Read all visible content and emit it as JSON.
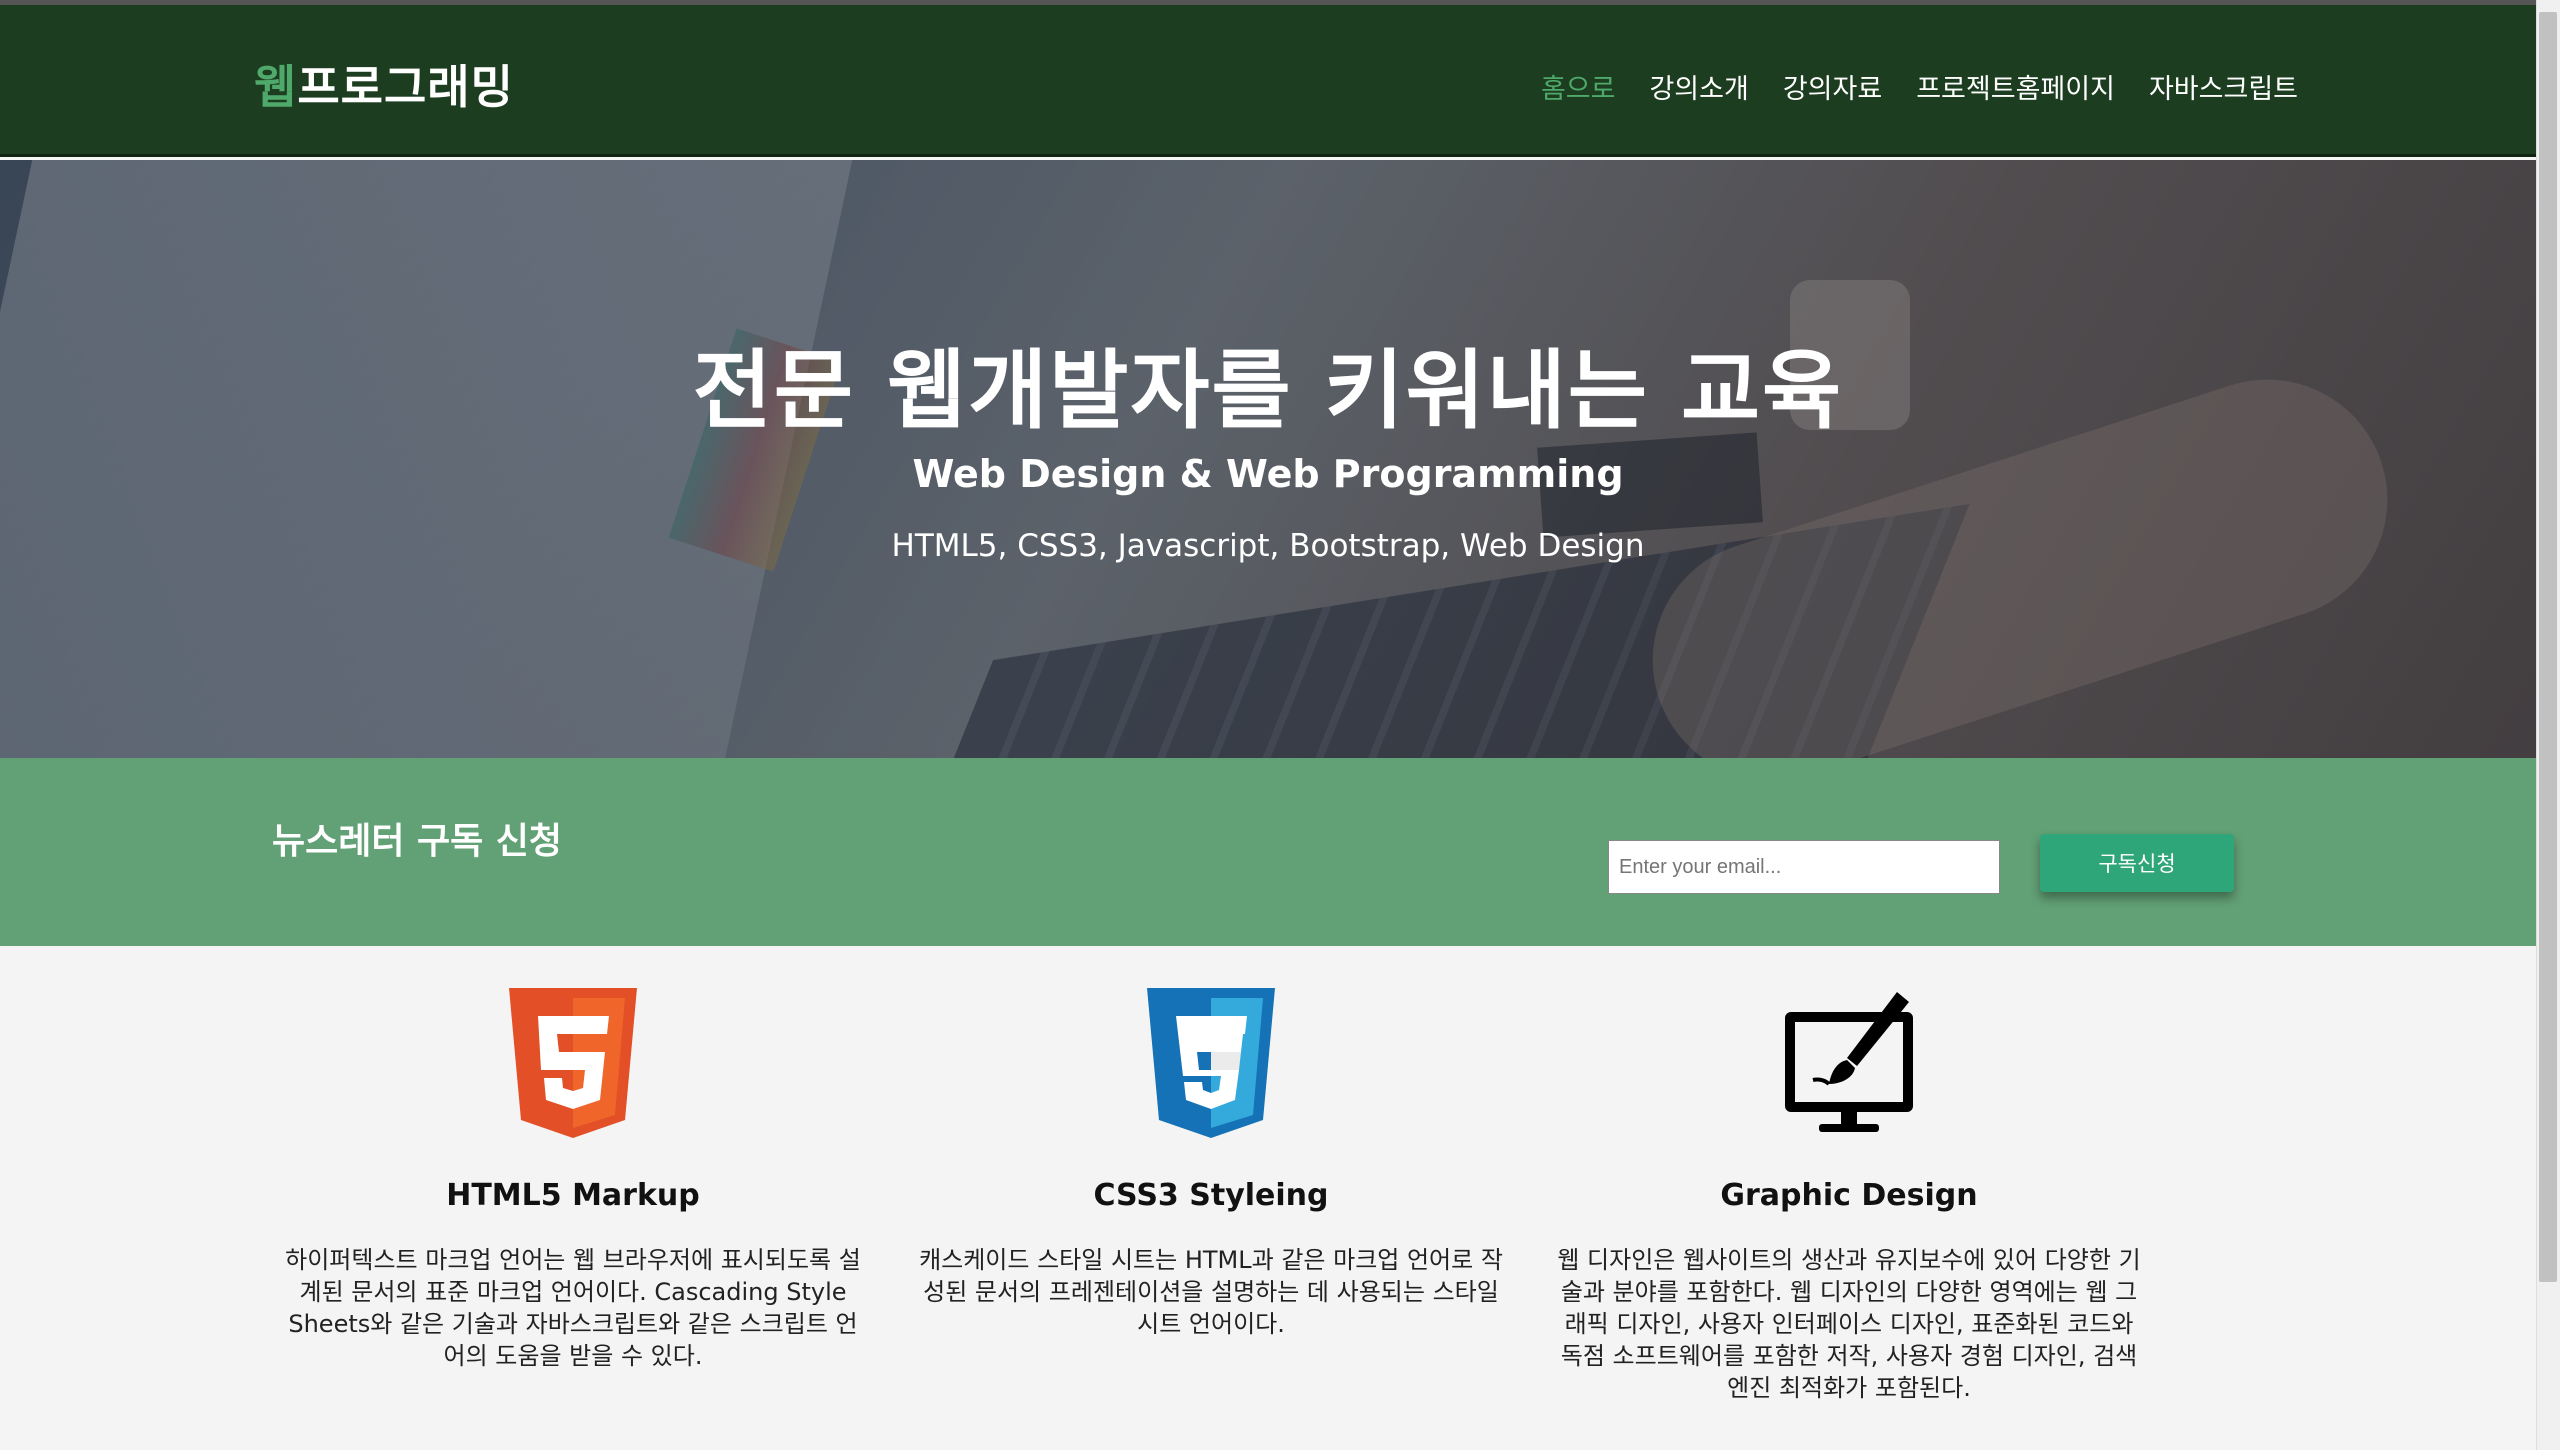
{
  "navbar": {
    "brand_accent": "웹",
    "brand_rest": "프로그래밍",
    "links": [
      "홈으로",
      "강의소개",
      "강의자료",
      "프로젝트홈페이지",
      "자바스크립트"
    ],
    "active_index": 0
  },
  "hero": {
    "title": "전문 웹개발자를 키워내는 교육",
    "subtitle": "Web Design & Web Programming",
    "tagline": "HTML5, CSS3, Javascript, Bootstrap, Web Design"
  },
  "newsletter": {
    "heading": "뉴스레터 구독 신청",
    "email_placeholder": "Enter your email...",
    "button_label": "구독신청"
  },
  "features": [
    {
      "icon": "html5-logo-icon",
      "title": "HTML5 Markup",
      "text": "하이퍼텍스트 마크업 언어는 웹 브라우저에 표시되도록 설계된 문서의 표준 마크업 언어이다. Cascading Style Sheets와 같은 기술과 자바스크립트와 같은 스크립트 언어의 도움을 받을 수 있다."
    },
    {
      "icon": "css3-logo-icon",
      "title": "CSS3 Styleing",
      "text": "캐스케이드 스타일 시트는 HTML과 같은 마크업 언어로 작성된 문서의 프레젠테이션을 설명하는 데 사용되는 스타일 시트 언어이다."
    },
    {
      "icon": "monitor-brush-icon",
      "title": "Graphic Design",
      "text": "웹 디자인은 웹사이트의 생산과 유지보수에 있어 다양한 기술과 분야를 포함한다. 웹 디자인의 다양한 영역에는 웹 그래픽 디자인, 사용자 인터페이스 디자인, 표준화된 코드와 독점 소프트웨어를 포함한 저작, 사용자 경험 디자인, 검색 엔진 최적화가 포함된다."
    }
  ],
  "colors": {
    "navbar": "#1c3d20",
    "accent": "#4fa96a",
    "newsletter": "#62a075",
    "button": "#2fa57a"
  }
}
